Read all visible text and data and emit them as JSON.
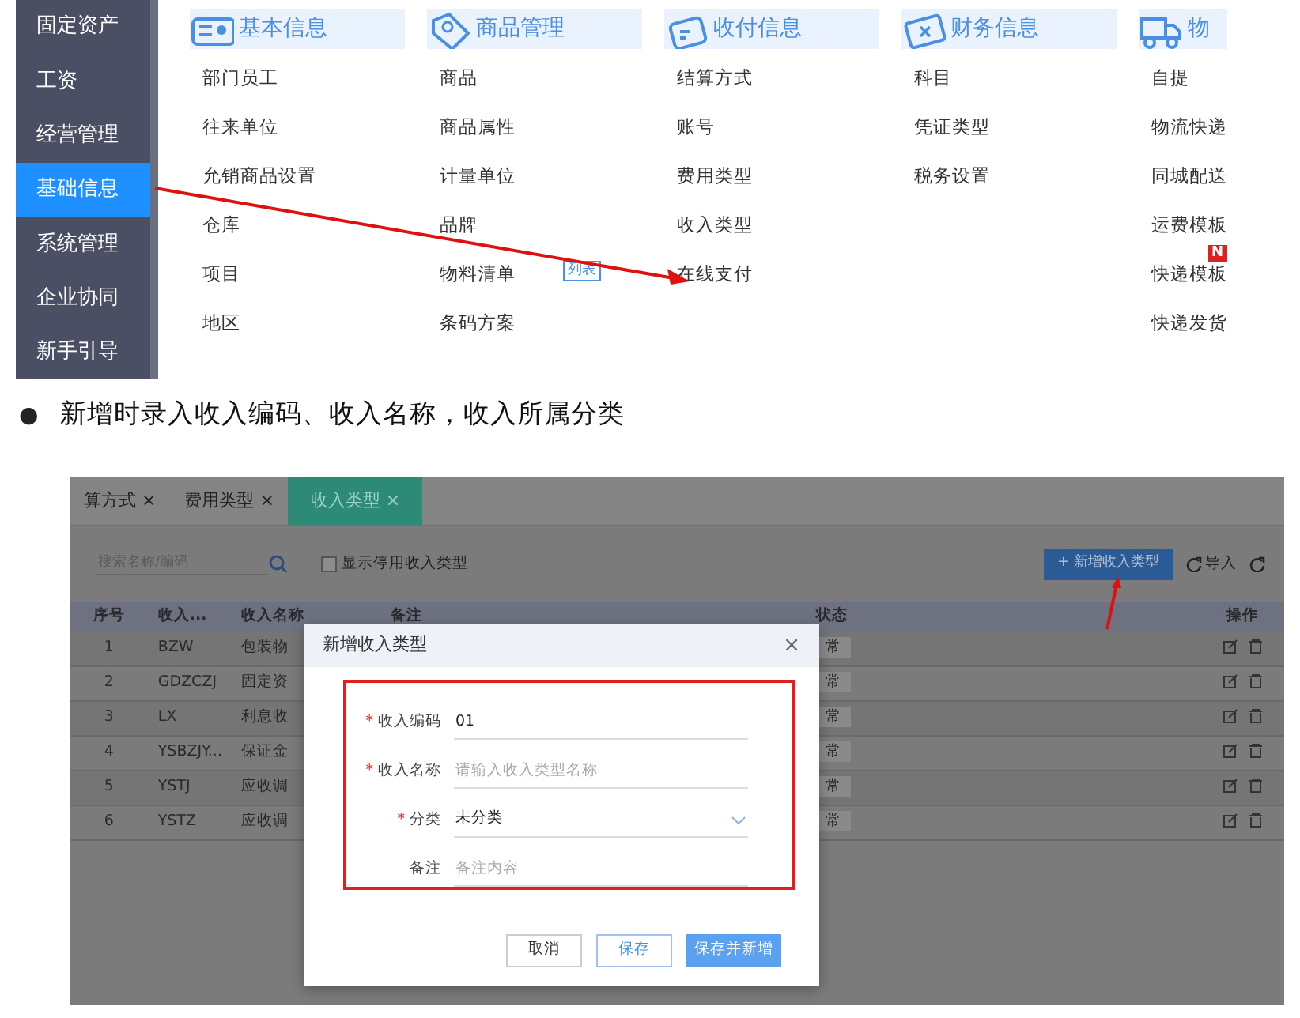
{
  "top_screenshot": {
    "sidebar": [
      {
        "label": "固定资产",
        "selected": false
      },
      {
        "label": "工资",
        "selected": false
      },
      {
        "label": "经营管理",
        "selected": false
      },
      {
        "label": "基础信息",
        "selected": true
      },
      {
        "label": "系统管理",
        "selected": false
      },
      {
        "label": "企业协同",
        "selected": false
      },
      {
        "label": "新手引导",
        "selected": false
      }
    ],
    "menu_columns": [
      {
        "title": "基本信息",
        "items": [
          {
            "label": "部门员工"
          },
          {
            "label": "往来单位"
          },
          {
            "label": "允销商品设置"
          },
          {
            "label": "仓库"
          },
          {
            "label": "项目"
          },
          {
            "label": "地区"
          }
        ]
      },
      {
        "title": "商品管理",
        "items": [
          {
            "label": "商品"
          },
          {
            "label": "商品属性"
          },
          {
            "label": "计量单位"
          },
          {
            "label": "品牌"
          },
          {
            "label": "物料清单",
            "badge": "列表"
          },
          {
            "label": "条码方案"
          }
        ]
      },
      {
        "title": "收付信息",
        "items": [
          {
            "label": "结算方式"
          },
          {
            "label": "账号"
          },
          {
            "label": "费用类型"
          },
          {
            "label": "收入类型"
          },
          {
            "label": "在线支付"
          }
        ]
      },
      {
        "title": "财务信息",
        "items": [
          {
            "label": "科目"
          },
          {
            "label": "凭证类型"
          },
          {
            "label": "税务设置"
          }
        ]
      },
      {
        "title": "物",
        "items": [
          {
            "label": "自提"
          },
          {
            "label": "物流快递"
          },
          {
            "label": "同城配送"
          },
          {
            "label": "运费模板"
          },
          {
            "label": "快递模板",
            "new_badge": "N"
          },
          {
            "label": "快递发货"
          }
        ]
      }
    ]
  },
  "bullet": {
    "mark": "●",
    "text": "新增时录入收入编码、收入名称，收入所属分类"
  },
  "bottom_screenshot": {
    "tabs": [
      {
        "label": "算方式 ×",
        "selected": false
      },
      {
        "label": "费用类型 ×",
        "selected": false
      },
      {
        "label": "收入类型 ×",
        "selected": true
      }
    ],
    "search": {
      "placeholder": "搜索名称/编码"
    },
    "show_disabled": {
      "label": "显示停用收入类型",
      "checked": false
    },
    "add_button": "+ 新增收入类型",
    "import_button": "导入",
    "table": {
      "columns": [
        "序号",
        "收入...",
        "收入名称",
        "备注",
        "状态",
        "操作"
      ],
      "rows": [
        {
          "index": "1",
          "code": "BZW",
          "name": "包装物",
          "status": "常"
        },
        {
          "index": "2",
          "code": "GDZCZJ",
          "name": "固定资",
          "status": "常"
        },
        {
          "index": "3",
          "code": "LX",
          "name": "利息收",
          "status": "常"
        },
        {
          "index": "4",
          "code": "YSBZJY...",
          "name": "保证金",
          "status": "常"
        },
        {
          "index": "5",
          "code": "YSTJ",
          "name": "应收调",
          "status": "常"
        },
        {
          "index": "6",
          "code": "YSTZ",
          "name": "应收调",
          "status": "常"
        }
      ]
    },
    "dialog": {
      "title": "新增收入类型",
      "close": "×",
      "fields": [
        {
          "label": "收入编码",
          "required_mark": "*",
          "kind": "input",
          "value": "01"
        },
        {
          "label": "收入名称",
          "required_mark": "*",
          "kind": "input",
          "placeholder": "请输入收入类型名称"
        },
        {
          "label": "分类",
          "required_mark": "*",
          "kind": "select",
          "value": "未分类"
        },
        {
          "label": "备注",
          "kind": "input",
          "placeholder": "备注内容"
        }
      ],
      "buttons": [
        {
          "label": "取消",
          "kind": "default"
        },
        {
          "label": "保存",
          "kind": "outline"
        },
        {
          "label": "保存并新增",
          "kind": "primary"
        }
      ]
    }
  }
}
